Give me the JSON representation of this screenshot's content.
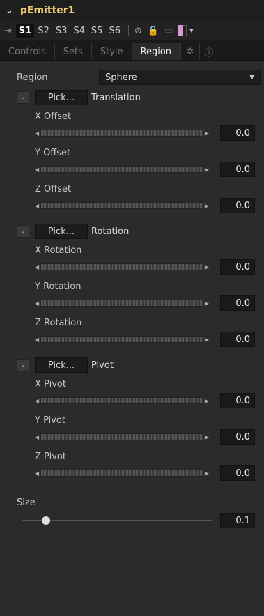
{
  "header": {
    "title": "pEmitter1"
  },
  "versions": {
    "items": [
      "S1",
      "S2",
      "S3",
      "S4",
      "S5",
      "S6"
    ],
    "active": "S1"
  },
  "tabs": [
    {
      "label": "Controls"
    },
    {
      "label": "Sets"
    },
    {
      "label": "Style"
    },
    {
      "label": "Region"
    }
  ],
  "region": {
    "label": "Region",
    "value": "Sphere"
  },
  "groups": [
    {
      "pick": "Pick...",
      "label": "Translation",
      "sliders": [
        {
          "label": "X Offset",
          "value": "0.0"
        },
        {
          "label": "Y Offset",
          "value": "0.0"
        },
        {
          "label": "Z Offset",
          "value": "0.0"
        }
      ]
    },
    {
      "pick": "Pick...",
      "label": "Rotation",
      "sliders": [
        {
          "label": "X Rotation",
          "value": "0.0"
        },
        {
          "label": "Y Rotation",
          "value": "0.0"
        },
        {
          "label": "Z Rotation",
          "value": "0.0"
        }
      ]
    },
    {
      "pick": "Pick...",
      "label": "Pivot",
      "sliders": [
        {
          "label": "X Pivot",
          "value": "0.0"
        },
        {
          "label": "Y Pivot",
          "value": "0.0"
        },
        {
          "label": "Z Pivot",
          "value": "0.0"
        }
      ]
    }
  ],
  "size": {
    "label": "Size",
    "value": "0.1"
  },
  "colors": {
    "accent_title": "#f0d070",
    "swatch": "#d89ad0"
  }
}
